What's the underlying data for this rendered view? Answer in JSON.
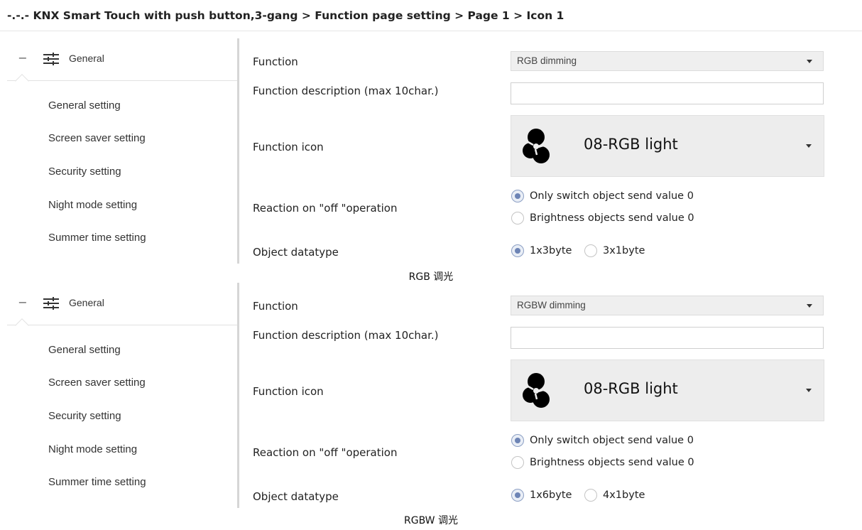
{
  "title_bar": {
    "text": "-.-.- KNX Smart Touch with push button,3-gang > Function page setting > Page 1 > Icon 1"
  },
  "panels": [
    {
      "sidebar": {
        "collapse_glyph": "−",
        "header_label": "General",
        "header_icon": "sliders-icon",
        "items": [
          {
            "label": "General setting"
          },
          {
            "label": "Screen saver setting"
          },
          {
            "label": "Security setting"
          },
          {
            "label": "Night mode setting"
          },
          {
            "label": "Summer time setting"
          }
        ]
      },
      "params": {
        "function_label": "Function",
        "function_value": "RGB dimming",
        "description_label": "Function description (max 10char.)",
        "description_value": "",
        "icon_label": "Function icon",
        "icon_value": "08-RGB light",
        "reaction_label": "Reaction on \"off \"operation",
        "reaction_options": [
          {
            "label": "Only switch object send value 0",
            "selected": true
          },
          {
            "label": "Brightness objects send value 0",
            "selected": false
          }
        ],
        "datatype_label": "Object datatype",
        "datatype_options": [
          {
            "label": "1x3byte",
            "selected": true
          },
          {
            "label": "3x1byte",
            "selected": false
          }
        ]
      },
      "caption": "RGB 调光"
    },
    {
      "sidebar": {
        "collapse_glyph": "−",
        "header_label": "General",
        "header_icon": "sliders-icon",
        "items": [
          {
            "label": "General setting"
          },
          {
            "label": "Screen saver setting"
          },
          {
            "label": "Security setting"
          },
          {
            "label": "Night mode setting"
          },
          {
            "label": "Summer time setting"
          }
        ]
      },
      "params": {
        "function_label": "Function",
        "function_value": "RGBW dimming",
        "description_label": "Function description (max 10char.)",
        "description_value": "",
        "icon_label": "Function icon",
        "icon_value": "08-RGB light",
        "reaction_label": "Reaction on \"off \"operation",
        "reaction_options": [
          {
            "label": "Only switch object send value 0",
            "selected": true
          },
          {
            "label": "Brightness objects send value 0",
            "selected": false
          }
        ],
        "datatype_label": "Object datatype",
        "datatype_options": [
          {
            "label": "1x6byte",
            "selected": true
          },
          {
            "label": "4x1byte",
            "selected": false
          }
        ]
      },
      "caption": "RGBW 调光"
    }
  ]
}
